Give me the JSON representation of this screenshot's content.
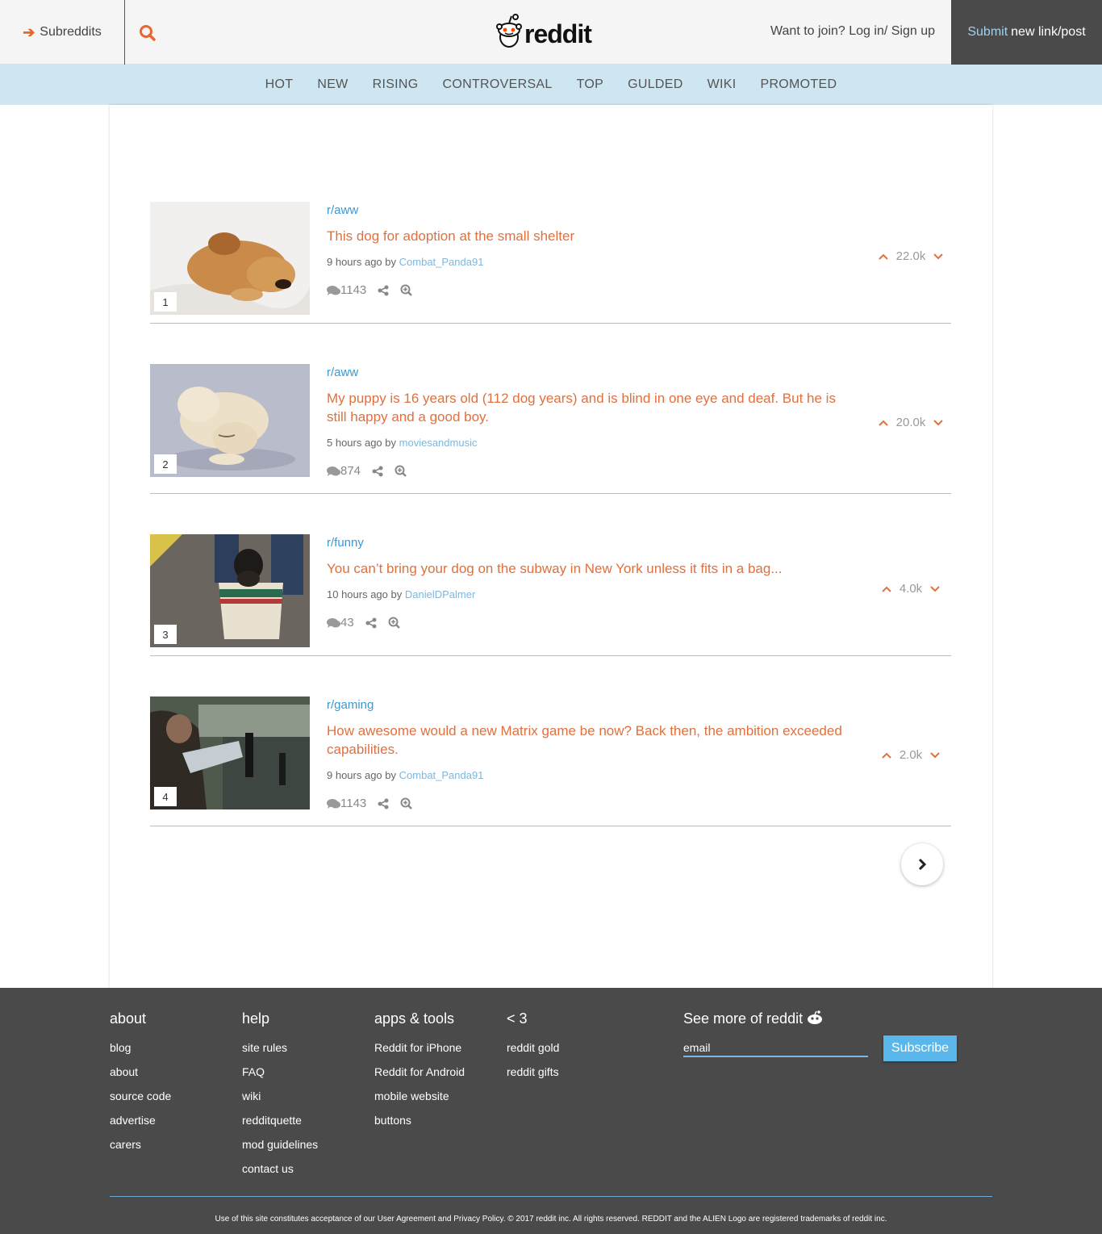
{
  "header": {
    "subreddits_label": "Subreddits",
    "logo_text": "reddit",
    "join_text": "Want to join? Log in/ Sign up",
    "submit_accent": "Submit",
    "submit_rest": "new link/post"
  },
  "nav": [
    "HOT",
    "NEW",
    "RISING",
    "CONTROVERSAL",
    "TOP",
    "GULDED",
    "WIKI",
    "PROMOTED"
  ],
  "posts": [
    {
      "rank": "1",
      "subreddit": "r/aww",
      "title": "This dog for adoption at the small shelter",
      "time": "9 hours ago by",
      "user": "Combat_Panda91",
      "comments": "1143",
      "score": "22.0k"
    },
    {
      "rank": "2",
      "subreddit": "r/aww",
      "title": "My puppy is 16 years old (112 dog years) and is blind in one eye and deaf. But he is still happy and a good boy.",
      "time": "5 hours ago by",
      "user": "moviesandmusic",
      "comments": "874",
      "score": "20.0k"
    },
    {
      "rank": "3",
      "subreddit": "r/funny",
      "title": "You can’t bring your dog on the subway in New York unless it fits in a bag...",
      "time": "10 hours ago by",
      "user": "DanielDPalmer",
      "comments": "43",
      "score": "4.0k"
    },
    {
      "rank": "4",
      "subreddit": "r/gaming",
      "title": "How awesome would a new Matrix game be now? Back then, the ambition exceeded capabilities.",
      "time": "9 hours ago by",
      "user": "Combat_Panda91",
      "comments": "1143",
      "score": "2.0k"
    }
  ],
  "footer": {
    "about": {
      "title": "about",
      "links": [
        "blog",
        "about",
        "source code",
        "advertise",
        "carers"
      ]
    },
    "help": {
      "title": "help",
      "links": [
        "site rules",
        "FAQ",
        "wiki",
        "redditquette",
        "mod guidelines",
        "contact us"
      ]
    },
    "apps": {
      "title": "apps & tools",
      "links": [
        "Reddit for iPhone",
        "Reddit for Android",
        "mobile website",
        "buttons"
      ]
    },
    "love": {
      "title": "< 3",
      "links": [
        "reddit gold",
        "reddit gifts"
      ]
    },
    "see_more": "See more of reddit",
    "email_placeholder": "email",
    "subscribe_label": "Subscribe",
    "legal": "Use of this site constitutes acceptance of our User Agreement and Privacy Policy. © 2017 reddit inc. All rights reserved. REDDIT and the ALIEN Logo are registered trademarks of reddit inc."
  },
  "colors": {
    "accent": "#e0703e",
    "link_blue": "#3a98d6",
    "nav_bg": "#cde6f1",
    "footer_bg": "#4a4a4a",
    "subscribe": "#5ab7ec"
  }
}
